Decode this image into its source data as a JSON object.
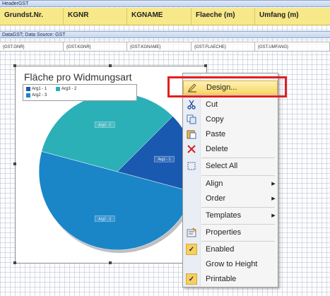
{
  "bands": {
    "header_band_label": "HeaderGST",
    "data_band_label": "DataGST; Data Source: GST"
  },
  "header_columns": [
    "Grundst.Nr.",
    "KGNR",
    "KGNAME",
    "Flaeche (m)",
    "Umfang (m)"
  ],
  "data_fields": [
    "{GST.GNR}",
    "{GST.KGNR}",
    "{GST.KGNAME}",
    "{GST.FLAECHE}",
    "{GST.UMFANG}"
  ],
  "chart": {
    "title": "Fläche pro Widmungsart",
    "legend": [
      "Arg1 - 1",
      "Arg3 - 2",
      "Arg2 - 3"
    ]
  },
  "chart_data": {
    "type": "pie",
    "series": [
      {
        "name": "Arg1",
        "value": 1,
        "label": "Arg1 - 1",
        "color": "#1a59b0"
      },
      {
        "name": "Arg3",
        "value": 2,
        "label": "Arg3 - 2",
        "color": "#2bb0b8"
      },
      {
        "name": "Arg2",
        "value": 3,
        "label": "Arg2 - 3",
        "color": "#1a86c8"
      }
    ]
  },
  "context_menu": {
    "items": [
      {
        "label": "Design...",
        "icon": "design-pencil-icon",
        "highlighted": true
      },
      {
        "label": "Cut",
        "icon": "scissors-icon"
      },
      {
        "label": "Copy",
        "icon": "copy-icon"
      },
      {
        "label": "Paste",
        "icon": "paste-icon"
      },
      {
        "label": "Delete",
        "icon": "delete-x-icon"
      },
      {
        "label": "Select All",
        "icon": "select-all-icon"
      },
      {
        "label": "Align",
        "submenu": true
      },
      {
        "label": "Order",
        "submenu": true
      },
      {
        "label": "Templates",
        "submenu": true
      },
      {
        "label": "Properties",
        "icon": "properties-icon"
      },
      {
        "label": "Enabled",
        "checked": true
      },
      {
        "label": "Grow to Height"
      },
      {
        "label": "Printable",
        "checked": true
      }
    ]
  },
  "colors": {
    "header_fill": "#f7e88a",
    "menu_highlight": "#f8d766",
    "annotation_red": "#e02020"
  }
}
